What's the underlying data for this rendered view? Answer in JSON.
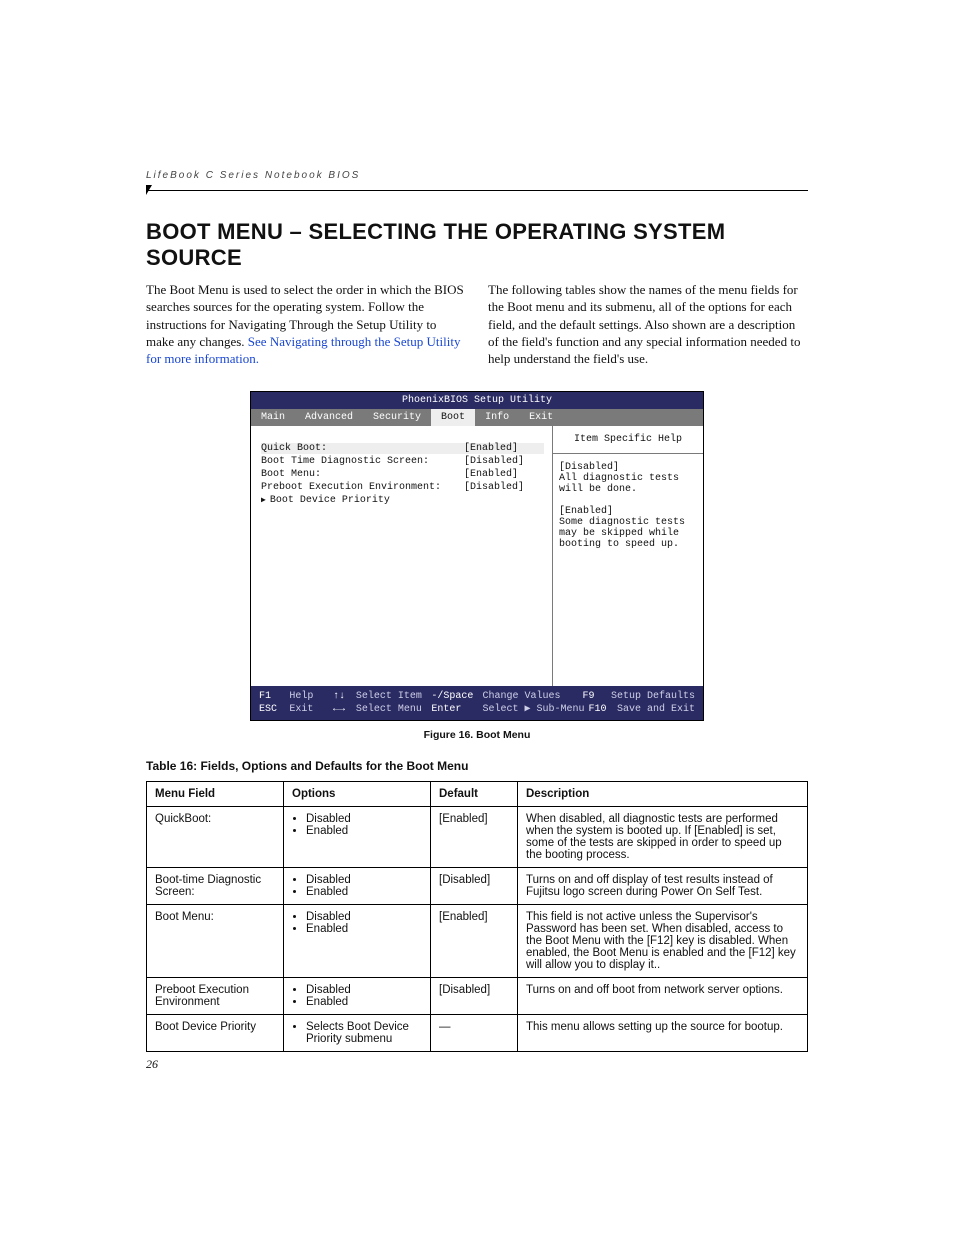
{
  "header": {
    "running": "LifeBook C Series Notebook BIOS"
  },
  "title": "BOOT MENU – SELECTING THE OPERATING SYSTEM SOURCE",
  "intro": {
    "left_a": "The Boot Menu is used to select the order in which the BIOS searches sources for the operating system. Follow the instructions for Navigating Through the Setup Utility to make any changes. ",
    "left_link": "See Navigating through the Setup Utility for more information.",
    "right": "The following tables show the names of the menu fields for the Boot menu and its submenu, all of the options for each field, and the default settings. Also shown are a description of the field's function and any special information needed to help understand the field's use."
  },
  "bios": {
    "title": "PhoenixBIOS Setup Utility",
    "menu": [
      "Main",
      "Advanced",
      "Security",
      "Boot",
      "Info",
      "Exit"
    ],
    "active_menu": "Boot",
    "rows": [
      {
        "k": "Quick Boot:",
        "v": "[Enabled]",
        "sel": true
      },
      {
        "k": "Boot Time Diagnostic Screen:",
        "v": "[Disabled]"
      },
      {
        "k": "Boot Menu:",
        "v": "[Enabled]"
      },
      {
        "k": "Preboot Execution Environment:",
        "v": "[Disabled]"
      },
      {
        "k": "Boot Device Priority",
        "v": "",
        "sub": true
      }
    ],
    "help_title": "Item Specific Help",
    "help_body": "[Disabled]\nAll diagnostic tests will be done.\n\n[Enabled]\nSome diagnostic tests may be skipped while booting to speed up.",
    "footer": {
      "l1": {
        "a": "F1",
        "b": "Help",
        "c": "↑↓",
        "d": "Select Item",
        "e": "-/Space",
        "f": "Change Values",
        "g": "F9",
        "h": "Setup Defaults"
      },
      "l2": {
        "a": "ESC",
        "b": "Exit",
        "c": "←→",
        "d": "Select Menu",
        "e": "Enter",
        "f": "Select ▶ Sub-Menu",
        "g": "F10",
        "h": "Save and Exit"
      }
    }
  },
  "figure_caption": "Figure 16.  Boot Menu",
  "table_caption": "Table 16: Fields, Options and Defaults for the Boot Menu",
  "table": {
    "head": [
      "Menu Field",
      "Options",
      "Default",
      "Description"
    ],
    "rows": [
      {
        "f": "QuickBoot:",
        "o": [
          "Disabled",
          "Enabled"
        ],
        "d": "[Enabled]",
        "desc": "When disabled, all diagnostic tests are performed when the system is booted up. If [Enabled] is set, some of the tests are skipped in order to speed up the booting process."
      },
      {
        "f": "Boot-time Diagnostic Screen:",
        "o": [
          "Disabled",
          "Enabled"
        ],
        "d": "[Disabled]",
        "desc": "Turns on and off display of test results instead of Fujitsu logo screen during Power On Self Test."
      },
      {
        "f": "Boot Menu:",
        "o": [
          "Disabled",
          "Enabled"
        ],
        "d": "[Enabled]",
        "desc": "This field is not active unless the Supervisor's Password has been set. When disabled, access to the Boot Menu with the [F12] key is disabled. When enabled, the Boot Menu is enabled and the [F12] key will allow you to display it.."
      },
      {
        "f": "Preboot Execution Environment",
        "o": [
          "Disabled",
          "Enabled"
        ],
        "d": "[Disabled]",
        "desc": "Turns on and off boot from network server options."
      },
      {
        "f": "Boot Device Priority",
        "o": [
          "Selects Boot Device Priority submenu"
        ],
        "d": "—",
        "desc": "This menu allows setting up the source for bootup."
      }
    ]
  },
  "page_number": "26"
}
